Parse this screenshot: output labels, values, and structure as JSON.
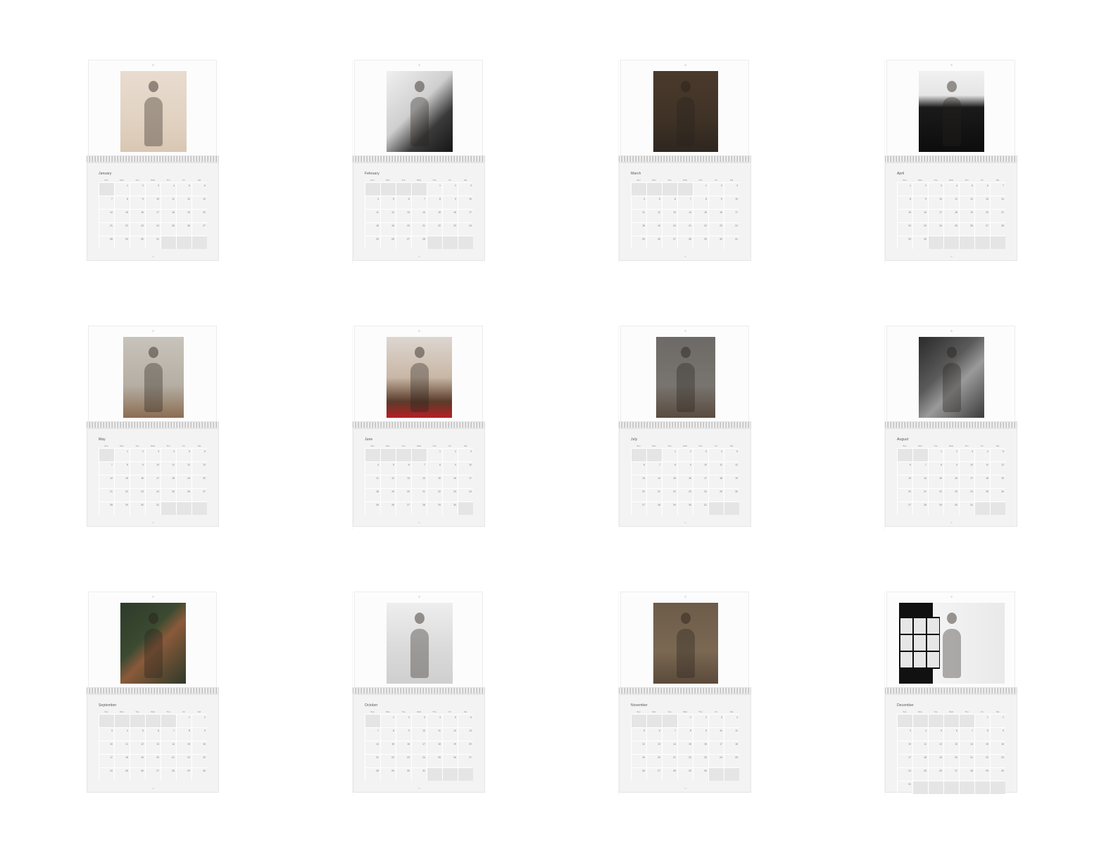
{
  "months": [
    {
      "name": "January",
      "days": 31,
      "offset": 1,
      "photo_class": "ph-jan",
      "photo_width": 94
    },
    {
      "name": "February",
      "days": 28,
      "offset": 4,
      "photo_class": "ph-feb",
      "photo_width": 94
    },
    {
      "name": "March",
      "days": 31,
      "offset": 4,
      "photo_class": "ph-mar",
      "photo_width": 92
    },
    {
      "name": "April",
      "days": 30,
      "offset": 0,
      "photo_class": "ph-apr",
      "photo_width": 93
    },
    {
      "name": "May",
      "days": 31,
      "offset": 1,
      "photo_class": "ph-may",
      "photo_width": 86
    },
    {
      "name": "June",
      "days": 30,
      "offset": 4,
      "photo_class": "ph-jun",
      "photo_width": 93
    },
    {
      "name": "July",
      "days": 31,
      "offset": 2,
      "photo_class": "ph-jul",
      "photo_width": 84
    },
    {
      "name": "August",
      "days": 31,
      "offset": 2,
      "photo_class": "ph-aug",
      "photo_width": 93
    },
    {
      "name": "September",
      "days": 30,
      "offset": 5,
      "photo_class": "ph-sep",
      "photo_width": 93
    },
    {
      "name": "October",
      "days": 31,
      "offset": 1,
      "photo_class": "ph-oct",
      "photo_width": 94
    },
    {
      "name": "November",
      "days": 30,
      "offset": 3,
      "photo_class": "ph-nov",
      "photo_width": 92
    },
    {
      "name": "December",
      "days": 31,
      "offset": 5,
      "photo_class": "ph-dec",
      "photo_width": 150
    }
  ],
  "weekdays": [
    "Sun",
    "Mon",
    "Tue",
    "Wed",
    "Thu",
    "Fri",
    "Sat"
  ]
}
